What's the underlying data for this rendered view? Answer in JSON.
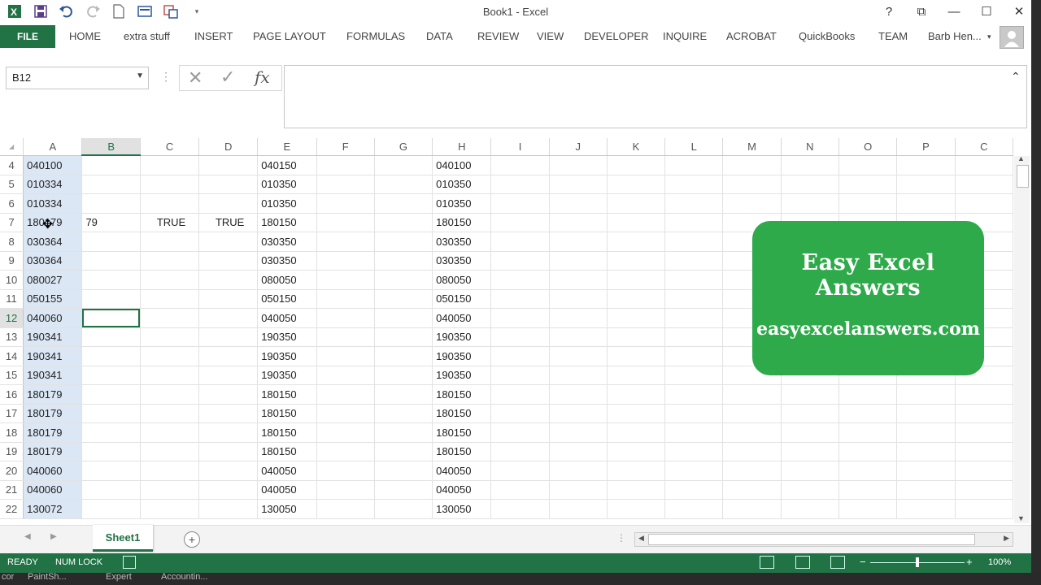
{
  "window": {
    "title": "Book1 - Excel",
    "help": "?",
    "restore_ribbon": "⧉",
    "minimize": "—",
    "maximize": "☐",
    "close": "✕"
  },
  "ribbon": {
    "file_tab": "FILE",
    "tabs": [
      "HOME",
      "extra stuff",
      "INSERT",
      "PAGE LAYOUT",
      "FORMULAS",
      "DATA",
      "REVIEW",
      "VIEW",
      "DEVELOPER",
      "INQUIRE",
      "ACROBAT",
      "QuickBooks",
      "TEAM"
    ],
    "user": "Barb Hen..."
  },
  "formula_bar": {
    "name_box": "B12",
    "cancel": "✕",
    "enter": "✓",
    "fx": "fx",
    "value": ""
  },
  "columns": [
    "A",
    "B",
    "C",
    "D",
    "E",
    "F",
    "G",
    "H",
    "I",
    "J",
    "K",
    "L",
    "M",
    "N",
    "O",
    "P",
    "C"
  ],
  "selected_column": "B",
  "selected_row": 12,
  "rows": [
    {
      "n": 4,
      "A": "040100",
      "B": "",
      "C": "",
      "D": "",
      "E": "040150",
      "H": "040100"
    },
    {
      "n": 5,
      "A": "010334",
      "B": "",
      "C": "",
      "D": "",
      "E": "010350",
      "H": "010350"
    },
    {
      "n": 6,
      "A": "010334",
      "B": "",
      "C": "",
      "D": "",
      "E": "010350",
      "H": "010350"
    },
    {
      "n": 7,
      "A": "180179",
      "B": "79",
      "C": "TRUE",
      "D": "TRUE",
      "E": "180150",
      "H": "180150"
    },
    {
      "n": 8,
      "A": "030364",
      "B": "",
      "C": "",
      "D": "",
      "E": "030350",
      "H": "030350"
    },
    {
      "n": 9,
      "A": "030364",
      "B": "",
      "C": "",
      "D": "",
      "E": "030350",
      "H": "030350"
    },
    {
      "n": 10,
      "A": "080027",
      "B": "",
      "C": "",
      "D": "",
      "E": "080050",
      "H": "080050"
    },
    {
      "n": 11,
      "A": "050155",
      "B": "",
      "C": "",
      "D": "",
      "E": "050150",
      "H": "050150"
    },
    {
      "n": 12,
      "A": "040060",
      "B": "",
      "C": "",
      "D": "",
      "E": "040050",
      "H": "040050"
    },
    {
      "n": 13,
      "A": "190341",
      "B": "",
      "C": "",
      "D": "",
      "E": "190350",
      "H": "190350"
    },
    {
      "n": 14,
      "A": "190341",
      "B": "",
      "C": "",
      "D": "",
      "E": "190350",
      "H": "190350"
    },
    {
      "n": 15,
      "A": "190341",
      "B": "",
      "C": "",
      "D": "",
      "E": "190350",
      "H": "190350"
    },
    {
      "n": 16,
      "A": "180179",
      "B": "",
      "C": "",
      "D": "",
      "E": "180150",
      "H": "180150"
    },
    {
      "n": 17,
      "A": "180179",
      "B": "",
      "C": "",
      "D": "",
      "E": "180150",
      "H": "180150"
    },
    {
      "n": 18,
      "A": "180179",
      "B": "",
      "C": "",
      "D": "",
      "E": "180150",
      "H": "180150"
    },
    {
      "n": 19,
      "A": "180179",
      "B": "",
      "C": "",
      "D": "",
      "E": "180150",
      "H": "180150"
    },
    {
      "n": 20,
      "A": "040060",
      "B": "",
      "C": "",
      "D": "",
      "E": "040050",
      "H": "040050"
    },
    {
      "n": 21,
      "A": "040060",
      "B": "",
      "C": "",
      "D": "",
      "E": "040050",
      "H": "040050"
    },
    {
      "n": 22,
      "A": "130072",
      "B": "",
      "C": "",
      "D": "",
      "E": "130050",
      "H": "130050"
    }
  ],
  "sheet_tabs": {
    "active": "Sheet1",
    "add": "+"
  },
  "status_bar": {
    "ready": "READY",
    "num_lock": "NUM LOCK",
    "zoom": "100%",
    "zoom_minus": "−",
    "zoom_plus": "+",
    "zoom_fraction": 0.5
  },
  "taskbar": [
    "cor",
    "PaintSh...",
    "Expert",
    "Accountin..."
  ],
  "badge": {
    "title": "Easy Excel Answers",
    "url": "easyexcelanswers.com"
  },
  "colors": {
    "excel_green": "#217346",
    "badge_green": "#2eaa4a",
    "column_a_fill": "#dbe7f4"
  },
  "icons": [
    "excel-logo-icon",
    "save-icon",
    "undo-icon",
    "redo-icon",
    "new-file-icon",
    "print-preview-icon",
    "paste-special-icon",
    "customize-qat-icon"
  ]
}
